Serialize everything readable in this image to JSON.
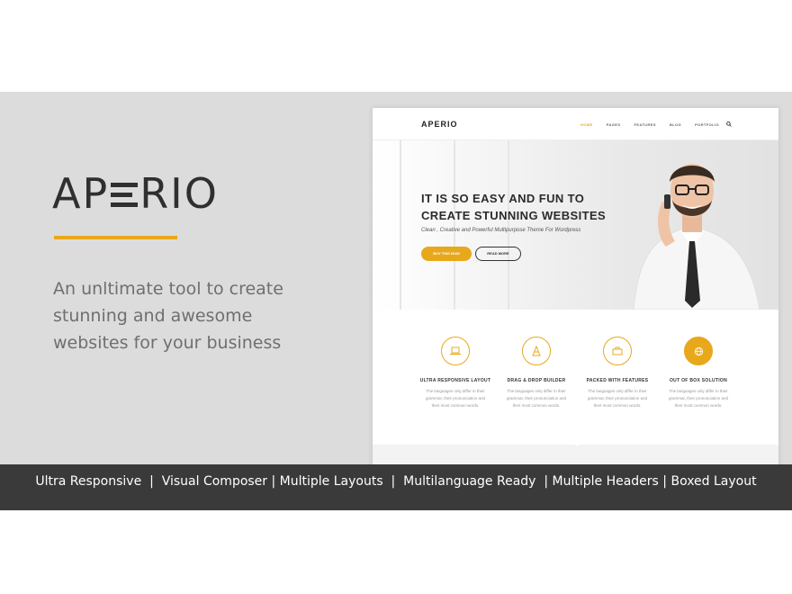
{
  "brand": {
    "logo_a": "AP",
    "logo_b": "RIO",
    "tagline": "An unltimate tool to create stunning and awesome websites for your business",
    "accent_color": "#e8a81c"
  },
  "preview": {
    "logo": "APERIO",
    "nav": [
      "HOME",
      "PAGES",
      "FEATURES",
      "BLOG",
      "PORTFOLIO"
    ],
    "search_icon": "search-icon",
    "hero_title_line1": "IT IS SO EASY AND FUN TO",
    "hero_title_line2": "CREATE STUNNING WEBSITES",
    "hero_subtitle": "Clean , Creative and Powerful Multipurpose Theme For Wordpress",
    "buy_button": "BUY THIS NOW",
    "read_button": "READ MORE",
    "features": [
      {
        "icon": "laptop-icon",
        "title": "ULTRA RESPONSIVE LAYOUT",
        "text": "The languages only differ in their grammar, their pronunciation and their most common words."
      },
      {
        "icon": "cone-icon",
        "title": "DRAG & DROP BUILDER",
        "text": "The languages only differ in their grammar, their pronunciation and their most common words."
      },
      {
        "icon": "briefcase-icon",
        "title": "PACKED WITH FEATURES",
        "text": "The languages only differ in their grammar, their pronunciation and their most common words."
      },
      {
        "icon": "globe-icon",
        "title": "OUT OF BOX SOLUTION",
        "text": "The languages only differ in their grammar, their pronunciation and their most common words."
      }
    ]
  },
  "features_bar": "Ultra Responsive  |  Visual Composer | Multiple Layouts  |  Multilanguage Ready  | Multiple Headers | Boxed Layout"
}
